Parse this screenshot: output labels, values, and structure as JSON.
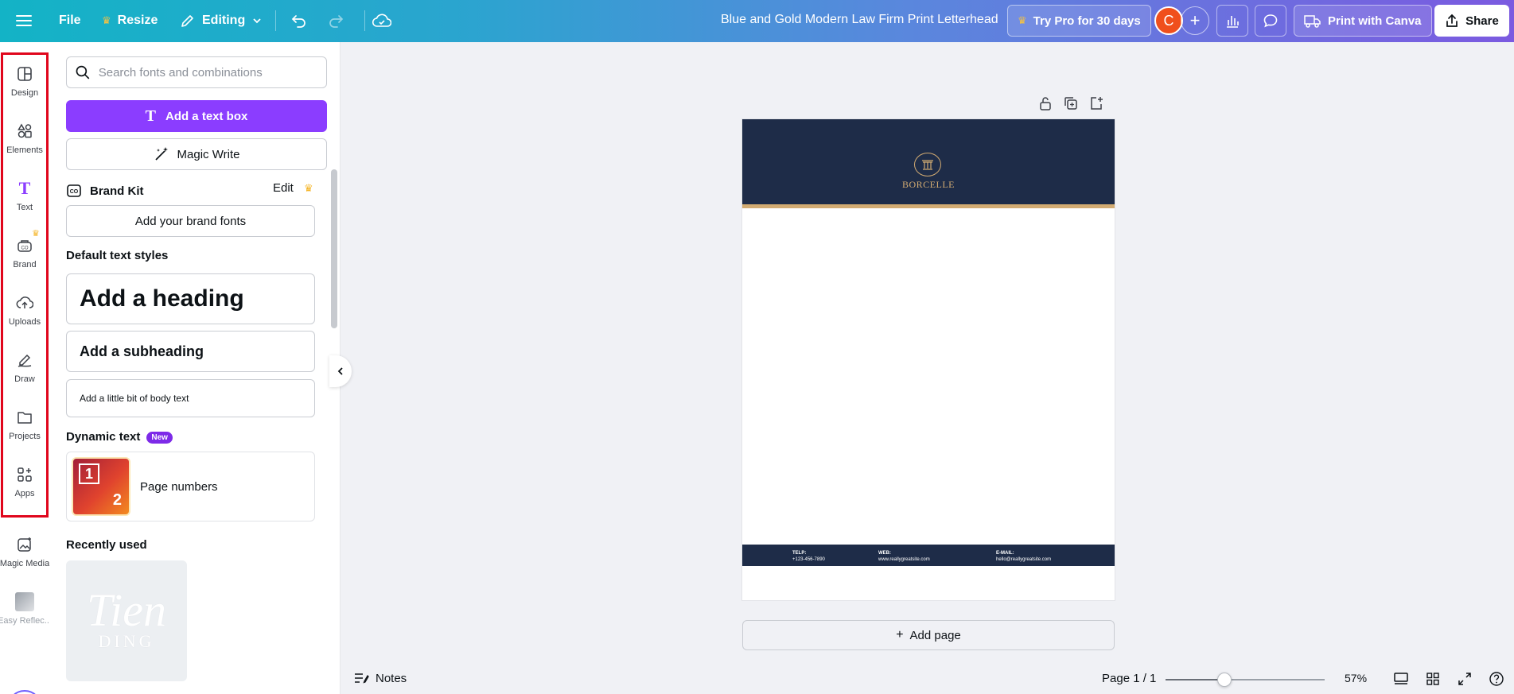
{
  "topbar": {
    "file_label": "File",
    "resize_label": "Resize",
    "editing_label": "Editing",
    "doc_title": "Blue and Gold Modern Law Firm Print Letterhead",
    "try_pro_label": "Try Pro for 30 days",
    "avatar_initial": "C",
    "print_label": "Print with Canva",
    "share_label": "Share"
  },
  "rail": {
    "items": [
      {
        "label": "Design",
        "icon": "design-icon"
      },
      {
        "label": "Elements",
        "icon": "elements-icon"
      },
      {
        "label": "Text",
        "icon": "text-icon"
      },
      {
        "label": "Brand",
        "icon": "brand-icon"
      },
      {
        "label": "Uploads",
        "icon": "uploads-icon"
      },
      {
        "label": "Draw",
        "icon": "draw-icon"
      },
      {
        "label": "Projects",
        "icon": "projects-icon"
      },
      {
        "label": "Apps",
        "icon": "apps-icon"
      },
      {
        "label": "Magic Media",
        "icon": "magic-media-icon"
      },
      {
        "label": "Easy Reflec...",
        "icon": "easy-reflection-icon"
      }
    ],
    "active": "Text"
  },
  "panel": {
    "search_placeholder": "Search fonts and combinations",
    "add_text_box": "Add a text box",
    "magic_write": "Magic Write",
    "brand_kit": "Brand Kit",
    "brand_edit": "Edit",
    "add_brand_fonts": "Add your brand fonts",
    "default_styles_title": "Default text styles",
    "heading": "Add a heading",
    "subheading": "Add a subheading",
    "body": "Add a little bit of body text",
    "dynamic_title": "Dynamic text",
    "new_badge": "New",
    "page_numbers": "Page numbers",
    "page_numbers_thumb_1": "1",
    "page_numbers_thumb_2": "2",
    "recently_used": "Recently used",
    "recent_thumb_big": "Tien",
    "recent_thumb_small": "DING"
  },
  "letterhead": {
    "company": "BORCELLE",
    "tel_label": "TELP:",
    "tel_value": "+123-456-7890",
    "web_label": "WEB:",
    "web_value": "www.reallygreatsite.com",
    "email_label": "E-MAIL:",
    "email_value": "hello@reallygreatsite.com",
    "colors": {
      "navy": "#1e2c48",
      "gold": "#d2ab72"
    }
  },
  "canvas": {
    "add_page": "Add page"
  },
  "bottombar": {
    "notes": "Notes",
    "page_info": "Page 1 / 1",
    "zoom": "57%",
    "zoom_fraction": 0.37
  },
  "colors": {
    "accent": "#8b3dff",
    "highlight": "#e0061c"
  }
}
